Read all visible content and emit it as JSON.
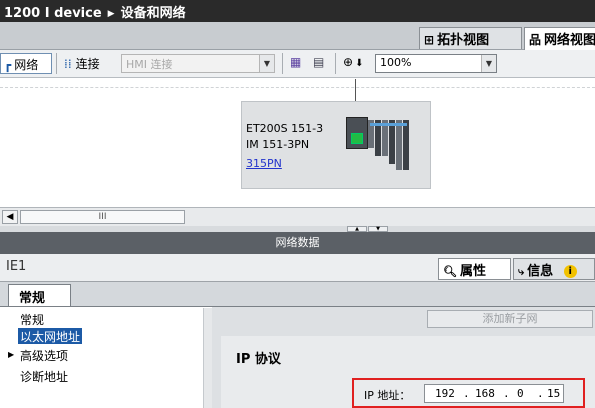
{
  "title": {
    "device": "1200 I device",
    "section": "设备和网络"
  },
  "view_tabs": {
    "topology": "拓扑视图",
    "network": "网络视图"
  },
  "toolbar": {
    "network": "网络",
    "connect": "连接",
    "hmi_combo": "HMI 连接",
    "zoom": "100%"
  },
  "device": {
    "name": "ET200S 151-3",
    "module": "IM 151-3PN",
    "link": "315PN"
  },
  "scroll_label": "III",
  "network_data": "网络数据",
  "inspector": {
    "object": "IE1",
    "properties_tab": "属性",
    "info_tab": "信息",
    "subtab": "常规"
  },
  "nav": [
    {
      "label": "常规"
    },
    {
      "label": "以太网地址"
    },
    {
      "label": "高级选项"
    },
    {
      "label": "诊断地址"
    }
  ],
  "add_subnet_button": "添加新子网",
  "ip_protocol": {
    "heading": "IP 协议",
    "label": "IP 地址：",
    "octets": [
      "192",
      "168",
      "0",
      "15"
    ]
  },
  "colors": {
    "highlight_box": "#e02020",
    "selection": "#1c5aa6",
    "link": "#2233cc"
  }
}
